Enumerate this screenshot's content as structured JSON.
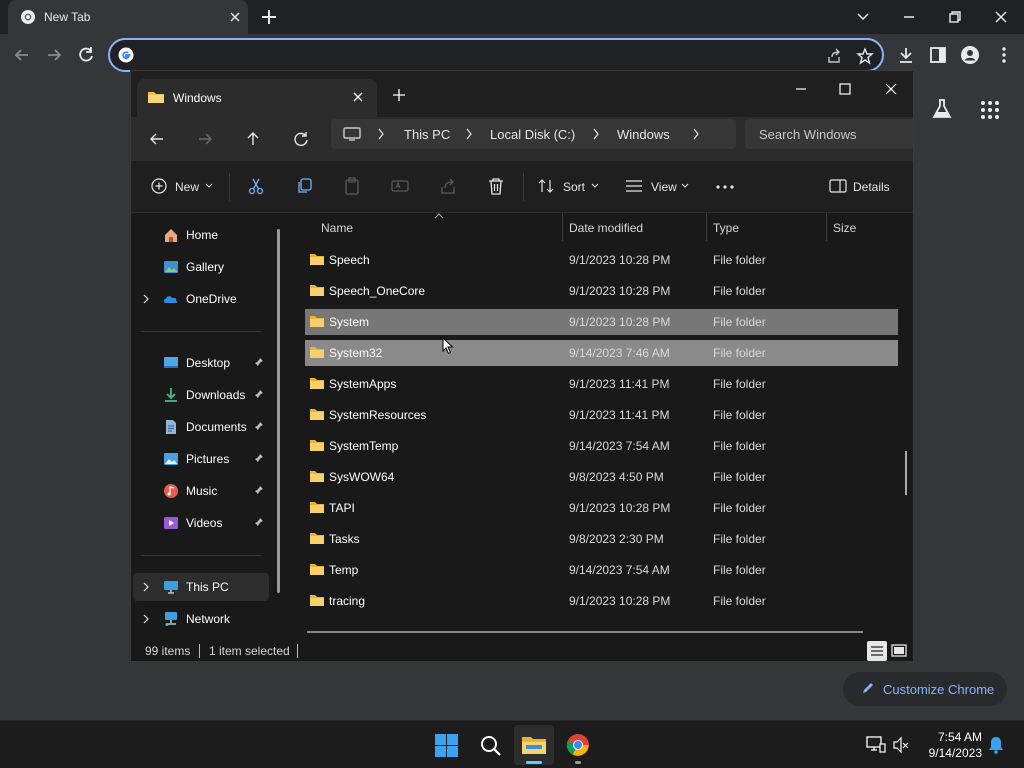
{
  "chrome": {
    "tab_title": "New Tab",
    "omnibox_value": "",
    "customize_label": "Customize Chrome",
    "accent": "#8ab4f8"
  },
  "explorer": {
    "tab_title": "Windows",
    "breadcrumb": [
      "This PC",
      "Local Disk (C:)",
      "Windows"
    ],
    "search_placeholder": "Search Windows",
    "commands": {
      "new": "New",
      "sort": "Sort",
      "view": "View",
      "details": "Details"
    },
    "nav": {
      "home": "Home",
      "gallery": "Gallery",
      "onedrive": "OneDrive",
      "desktop": "Desktop",
      "downloads": "Downloads",
      "documents": "Documents",
      "pictures": "Pictures",
      "music": "Music",
      "videos": "Videos",
      "this_pc": "This PC",
      "network": "Network"
    },
    "columns": {
      "name": "Name",
      "date": "Date modified",
      "type": "Type",
      "size": "Size"
    },
    "files": [
      {
        "name": "Speech",
        "date": "9/1/2023 10:28 PM",
        "type": "File folder"
      },
      {
        "name": "Speech_OneCore",
        "date": "9/1/2023 10:28 PM",
        "type": "File folder"
      },
      {
        "name": "System",
        "date": "9/1/2023 10:28 PM",
        "type": "File folder"
      },
      {
        "name": "System32",
        "date": "9/14/2023 7:46 AM",
        "type": "File folder"
      },
      {
        "name": "SystemApps",
        "date": "9/1/2023 11:41 PM",
        "type": "File folder"
      },
      {
        "name": "SystemResources",
        "date": "9/1/2023 11:41 PM",
        "type": "File folder"
      },
      {
        "name": "SystemTemp",
        "date": "9/14/2023 7:54 AM",
        "type": "File folder"
      },
      {
        "name": "SysWOW64",
        "date": "9/8/2023 4:50 PM",
        "type": "File folder"
      },
      {
        "name": "TAPI",
        "date": "9/1/2023 10:28 PM",
        "type": "File folder"
      },
      {
        "name": "Tasks",
        "date": "9/8/2023 2:30 PM",
        "type": "File folder"
      },
      {
        "name": "Temp",
        "date": "9/14/2023 7:54 AM",
        "type": "File folder"
      },
      {
        "name": "tracing",
        "date": "9/1/2023 10:28 PM",
        "type": "File folder"
      }
    ],
    "status": {
      "count": "99 items",
      "selected": "1 item selected"
    }
  },
  "taskbar": {
    "time": "7:54 AM",
    "date": "9/14/2023"
  },
  "icons": [
    "chrome-icon",
    "folder-icon",
    "home-icon",
    "gallery-icon",
    "onedrive-icon",
    "desktop-icon",
    "downloads-icon",
    "documents-icon",
    "pictures-icon",
    "music-icon",
    "videos-icon",
    "this-pc-icon",
    "network-icon",
    "windows-start-icon",
    "search-icon",
    "notification-bell-icon"
  ]
}
